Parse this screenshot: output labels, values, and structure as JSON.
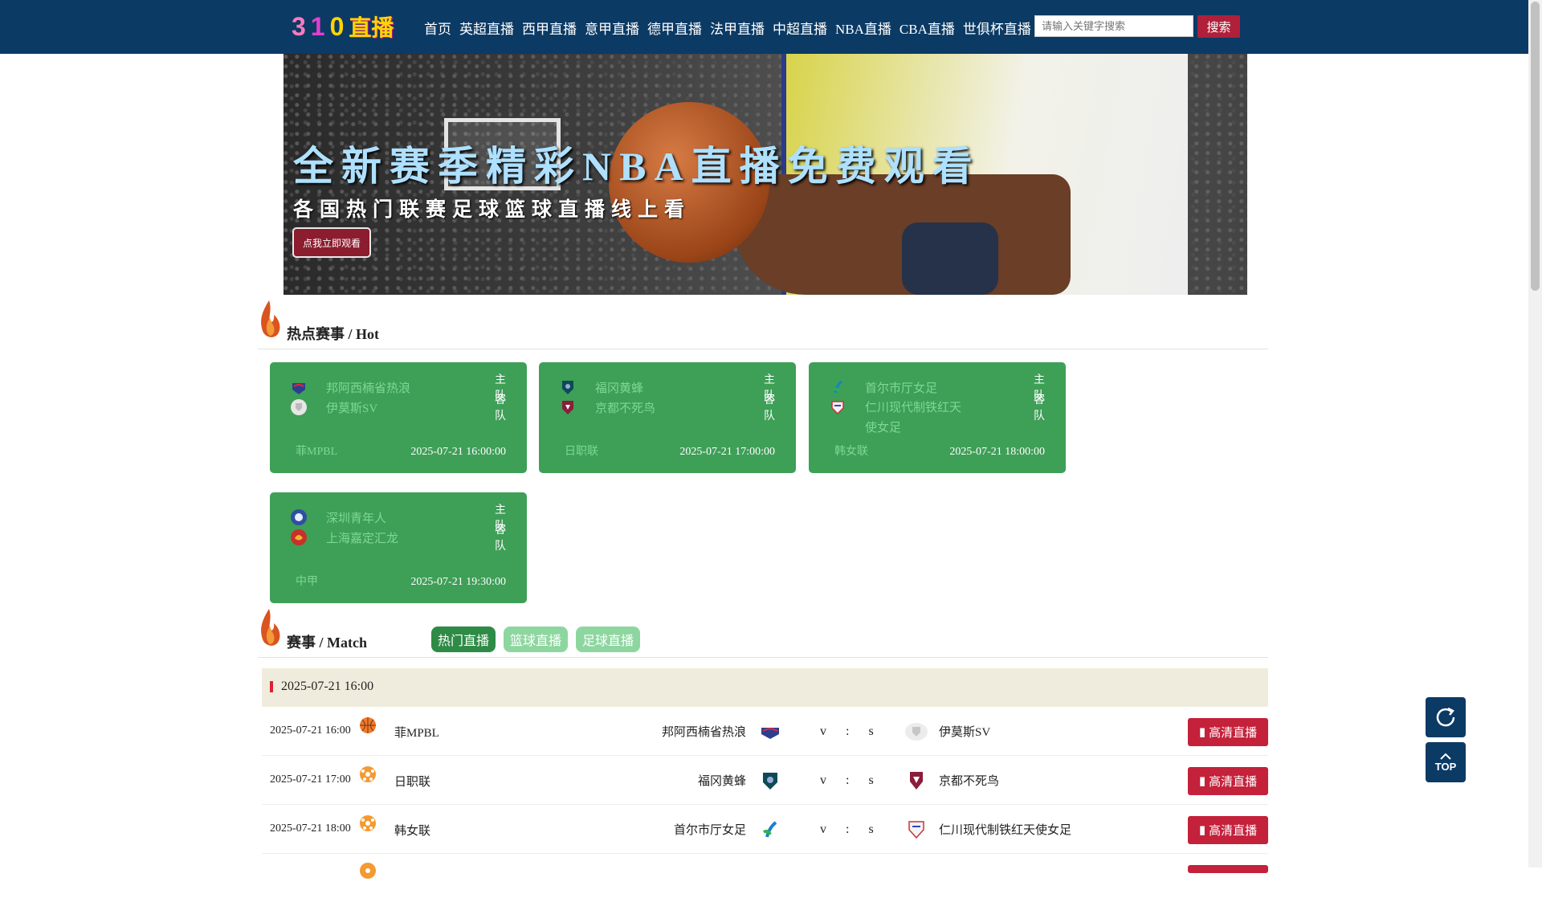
{
  "header": {
    "logo": {
      "digits": [
        "3",
        "1",
        "0"
      ],
      "text": "直播"
    },
    "nav": [
      "首页",
      "英超直播",
      "西甲直播",
      "意甲直播",
      "德甲直播",
      "法甲直播",
      "中超直播",
      "NBA直播",
      "CBA直播",
      "世俱杯直播"
    ],
    "search_placeholder": "请输入关键字搜索",
    "search_button": "搜索"
  },
  "banner": {
    "title": "全新赛季精彩NBA直播免费观看",
    "subtitle": "各国热门联赛足球篮球直播线上看",
    "cta": "点我立即观看"
  },
  "hot": {
    "title": "热点赛事 / Hot",
    "home_label": "主队",
    "away_label": "客队",
    "cards": [
      {
        "home": "邦阿西楠省热浪",
        "away": "伊莫斯SV",
        "league": "菲MPBL",
        "time": "2025-07-21 16:00:00"
      },
      {
        "home": "福冈黄蜂",
        "away": "京都不死鸟",
        "league": "日职联",
        "time": "2025-07-21 17:00:00"
      },
      {
        "home": "首尔市厅女足",
        "away": "仁川现代制铁红天使女足",
        "league": "韩女联",
        "time": "2025-07-21 18:00:00"
      },
      {
        "home": "深圳青年人",
        "away": "上海嘉定汇龙",
        "league": "中甲",
        "time": "2025-07-21 19:30:00"
      }
    ]
  },
  "match": {
    "title": "赛事 / Match",
    "tabs": [
      "热门直播",
      "篮球直播",
      "足球直播"
    ],
    "active_tab": 0,
    "date": "2025-07-21 16:00",
    "score_text": "v : s",
    "button_label": "高清直播",
    "rows": [
      {
        "time": "2025-07-21 16:00",
        "sport": "basketball",
        "league": "菲MPBL",
        "home": "邦阿西楠省热浪",
        "away": "伊莫斯SV"
      },
      {
        "time": "2025-07-21 17:00",
        "sport": "football",
        "league": "日职联",
        "home": "福冈黄蜂",
        "away": "京都不死鸟"
      },
      {
        "time": "2025-07-21 18:00",
        "sport": "football",
        "league": "韩女联",
        "home": "首尔市厅女足",
        "away": "仁川现代制铁红天使女足"
      }
    ]
  },
  "float": {
    "top_label": "TOP"
  },
  "colors": {
    "topbar": "#0b3a64",
    "card": "#3e9f57",
    "button": "#c4213b",
    "date_bar": "#f0ecdd"
  }
}
